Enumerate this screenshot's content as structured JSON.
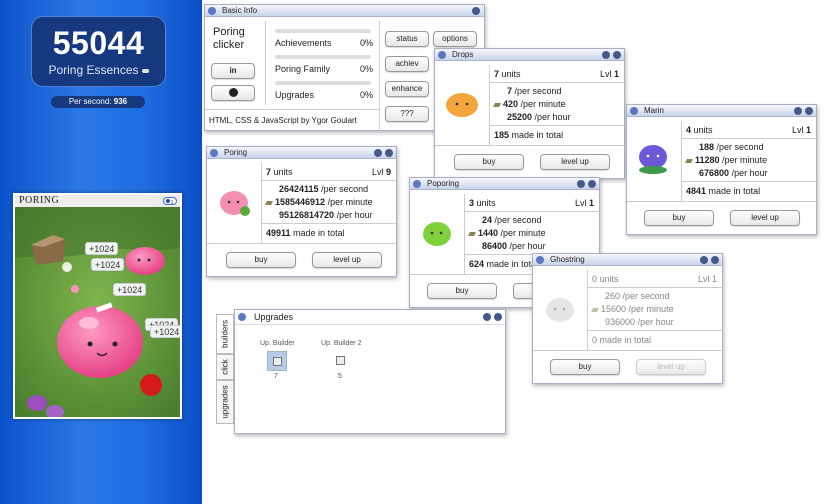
{
  "essences": {
    "count": "55044",
    "label": "Poring Essences",
    "per_second_label": "Per second:",
    "per_second": "936"
  },
  "scene": {
    "name": "Poring",
    "level": "1",
    "popups": [
      "+1024",
      "+1024",
      "+1024",
      "+1024",
      "+1024"
    ]
  },
  "basic_info": {
    "title": "Basic Info",
    "game_name": "Poring clicker",
    "linkedin": "in",
    "github": "github-icon",
    "progress": [
      {
        "label": "Achievements",
        "pct": "0%"
      },
      {
        "label": "Poring Family",
        "pct": "0%"
      },
      {
        "label": "Upgrades",
        "pct": "0%"
      }
    ],
    "buttons": [
      "status",
      "options",
      "achiev",
      "",
      "enhance",
      "",
      "???",
      ""
    ],
    "credit": "HTML, CSS & JavaScript by Ygor Goulart"
  },
  "units": [
    {
      "title": "Poring",
      "units": "7",
      "units_label": "units",
      "lvl_label": "Lvl",
      "lvl": "9",
      "per_second": "26424115",
      "per_minute": "1585446912",
      "per_hour": "95126814720",
      "total": "49911",
      "ps_suffix": "/per second",
      "pm_suffix": "/per minute",
      "ph_suffix": "/per hour",
      "total_suffix": "made in total",
      "buy": "buy",
      "levelup": "level up"
    },
    {
      "title": "Drops",
      "units": "7",
      "units_label": "units",
      "lvl_label": "Lvl",
      "lvl": "1",
      "per_second": "7",
      "per_minute": "420",
      "per_hour": "25200",
      "total": "185",
      "ps_suffix": "/per second",
      "pm_suffix": "/per minute",
      "ph_suffix": "/per hour",
      "total_suffix": "made in total",
      "buy": "buy",
      "levelup": "level up"
    },
    {
      "title": "Poporing",
      "units": "3",
      "units_label": "units",
      "lvl_label": "Lvl",
      "lvl": "1",
      "per_second": "24",
      "per_minute": "1440",
      "per_hour": "86400",
      "total": "624",
      "ps_suffix": "/per second",
      "pm_suffix": "/per minute",
      "ph_suffix": "/per hour",
      "total_suffix": "made in total",
      "buy": "buy",
      "levelup": "level up"
    },
    {
      "title": "Marin",
      "units": "4",
      "units_label": "units",
      "lvl_label": "Lvl",
      "lvl": "1",
      "per_second": "188",
      "per_minute": "11280",
      "per_hour": "676800",
      "total": "4841",
      "ps_suffix": "/per second",
      "pm_suffix": "/per minute",
      "ph_suffix": "/per hour",
      "total_suffix": "made in total",
      "buy": "buy",
      "levelup": "level up"
    },
    {
      "title": "Ghostring",
      "units": "0",
      "units_label": "units",
      "lvl_label": "Lvl",
      "lvl": "1",
      "per_second": "260",
      "per_minute": "15600",
      "per_hour": "936000",
      "total": "0",
      "ps_suffix": "/per second",
      "pm_suffix": "/per minute",
      "ph_suffix": "/per hour",
      "total_suffix": "made in total",
      "buy": "buy",
      "levelup": "level up"
    }
  ],
  "upgrades": {
    "title": "Upgrades",
    "tabs": [
      "builders",
      "click",
      "upgrades"
    ],
    "items": [
      {
        "label": "Up. Builder",
        "count": "7"
      },
      {
        "label": "Up. Builder 2",
        "count": "5"
      }
    ]
  },
  "colors": {
    "accent": "#1e6ee2",
    "panel": "#15387f"
  }
}
